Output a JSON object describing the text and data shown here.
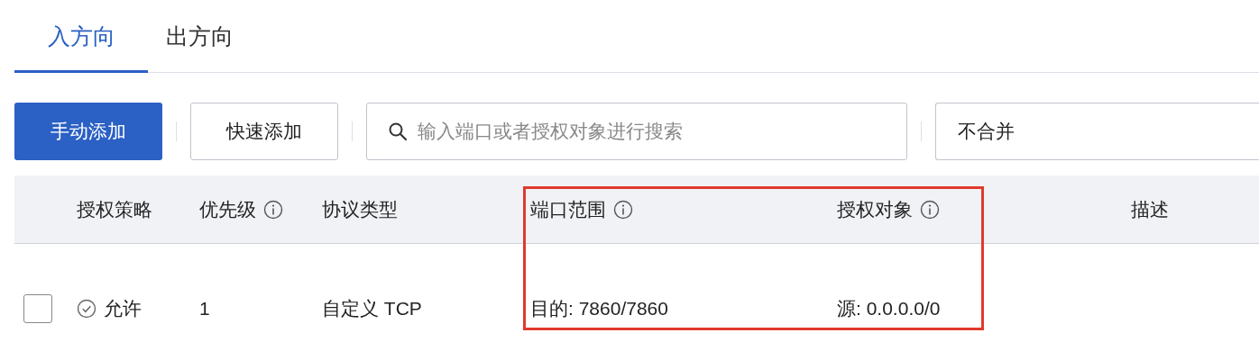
{
  "tabs": [
    {
      "label": "入方向",
      "selected": true
    },
    {
      "label": "出方向",
      "selected": false
    }
  ],
  "toolbar": {
    "buttons": [
      {
        "label": "手动添加",
        "kind": "primary"
      },
      {
        "label": "快速添加",
        "kind": "default"
      }
    ],
    "search": {
      "placeholder": "输入端口或者授权对象进行搜索"
    },
    "merge_select": {
      "value": "不合并"
    }
  },
  "table": {
    "columns": [
      {
        "label": "授权策略",
        "info": false
      },
      {
        "label": "优先级",
        "info": true
      },
      {
        "label": "协议类型",
        "info": false
      },
      {
        "label": "端口范围",
        "info": true
      },
      {
        "label": "授权对象",
        "info": true
      },
      {
        "label": "描述",
        "info": false
      }
    ],
    "rows": [
      {
        "checked": false,
        "policy": "允许",
        "priority": "1",
        "protocol": "自定义 TCP",
        "port_range": "目的: 7860/7860",
        "auth_target": "源: 0.0.0.0/0"
      }
    ]
  },
  "annotation": {
    "kind": "highlight_box"
  }
}
